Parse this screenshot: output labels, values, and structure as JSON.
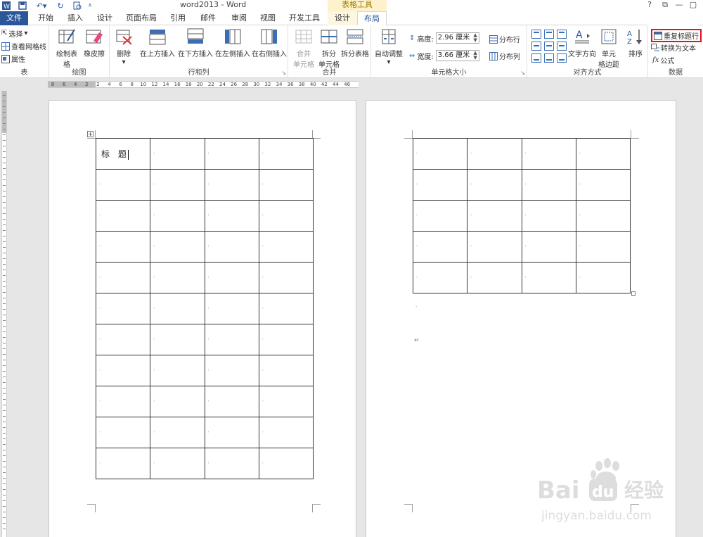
{
  "titlebar": {
    "doc_title": "word2013 - Word",
    "context_group": "表格工具",
    "help": "?",
    "ribbon_opts": "⧉",
    "minimize": "—",
    "maximize": "▢",
    "close": "✕"
  },
  "tabs": {
    "file": "文件",
    "home": "开始",
    "insert": "插入",
    "design": "设计",
    "page_layout": "页面布局",
    "references": "引用",
    "mailings": "邮件",
    "review": "审阅",
    "view": "视图",
    "developer": "开发工具",
    "table_design": "设计",
    "table_layout": "布局"
  },
  "ribbon": {
    "table_group": {
      "label": "表",
      "select": "选择",
      "view_gridlines": "查看网格线",
      "properties": "属性"
    },
    "draw_group": {
      "label": "绘图",
      "draw_table": "绘制表格",
      "eraser": "橡皮擦"
    },
    "rows_cols_group": {
      "label": "行和列",
      "delete": "删除",
      "insert_above": "在上方插入",
      "insert_below": "在下方插入",
      "insert_left": "在左侧插入",
      "insert_right": "在右侧插入"
    },
    "merge_group": {
      "label": "合并",
      "merge_cells_1": "合并",
      "merge_cells_2": "单元格",
      "split_cells_1": "拆分",
      "split_cells_2": "单元格",
      "split_table": "拆分表格"
    },
    "cell_size_group": {
      "label": "单元格大小",
      "autofit": "自动调整",
      "height_label": "高度:",
      "height_value": "2.96 厘米",
      "width_label": "宽度:",
      "width_value": "3.66 厘米",
      "distribute_rows": "分布行",
      "distribute_cols": "分布列"
    },
    "alignment_group": {
      "label": "对齐方式",
      "text_direction": "文字方向",
      "cell_margins_1": "单元",
      "cell_margins_2": "格边距"
    },
    "data_group": {
      "label": "数据",
      "sort": "排序",
      "repeat_header": "重复标题行",
      "convert_to_text": "转换为文本",
      "formula": "公式"
    }
  },
  "ruler": {
    "ticks": [
      "8",
      "6",
      "4",
      "2",
      "2",
      "4",
      "6",
      "8",
      "10",
      "12",
      "14",
      "16",
      "18",
      "20",
      "22",
      "24",
      "26",
      "28",
      "30",
      "32",
      "34",
      "36",
      "38",
      "40",
      "42",
      "44",
      "46"
    ]
  },
  "document": {
    "title_cell_text": "标 题",
    "cell_marker": "›",
    "paragraph_mark": "↵"
  }
}
